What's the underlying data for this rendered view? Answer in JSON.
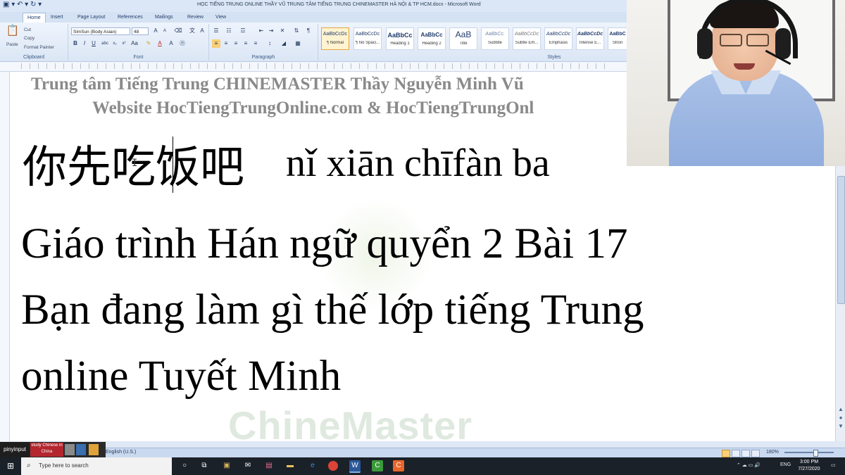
{
  "window": {
    "title": "HỌC TIẾNG TRUNG ONLINE THẦY VŨ TRUNG TÂM TIẾNG TRUNG CHINEMASTER HÀ NỘI & TP HCM.docx - Microsoft Word",
    "quick_access": "▣ ▾ ↶ ▾ ↻ ▾"
  },
  "ribbon": {
    "tabs": [
      "Home",
      "Insert",
      "Page Layout",
      "References",
      "Mailings",
      "Review",
      "View"
    ],
    "clipboard": {
      "label": "Clipboard",
      "paste": "Paste",
      "cut": "Cut",
      "copy": "Copy",
      "format_painter": "Format Painter"
    },
    "font": {
      "label": "Font",
      "name": "SimSun (Body Asian)",
      "size": "48"
    },
    "paragraph": {
      "label": "Paragraph"
    },
    "styles": {
      "label": "Styles",
      "items": [
        {
          "sample": "AaBbCcDc",
          "name": "¶ Normal"
        },
        {
          "sample": "AaBbCcDc",
          "name": "¶ No Spaci..."
        },
        {
          "sample": "AaBbCc",
          "name": "Heading 1"
        },
        {
          "sample": "AaBbCc",
          "name": "Heading 2"
        },
        {
          "sample": "AaB",
          "name": "Title"
        },
        {
          "sample": "AaBbCc.",
          "name": "Subtitle"
        },
        {
          "sample": "AaBbCcDc",
          "name": "Subtle Em..."
        },
        {
          "sample": "AaBbCcDc",
          "name": "Emphasis"
        },
        {
          "sample": "AaBbCcDc",
          "name": "Intense E..."
        },
        {
          "sample": "AaBbC",
          "name": "Stron"
        }
      ]
    }
  },
  "document": {
    "header_line1": "Trung tâm Tiếng Trung CHINEMASTER Thầy Nguyễn Minh Vũ",
    "header_line2": "Website HocTiengTrungOnline.com & HocTiengTrungOnl",
    "chinese": "你先吃饭吧",
    "pinyin": "nǐ xiān chīfàn ba",
    "body_line1": "Giáo trình Hán ngữ quyển 2 Bài 17",
    "body_line2": "Bạn đang làm gì thế lớp tiếng Trung",
    "body_line3": "online Tuyết Minh",
    "watermark": "ChineMaster"
  },
  "statusbar": {
    "language": "English (U.S.)",
    "zoom": "180%",
    "pinyinput": "pinyinput",
    "study_chinese": "study Chinese in China"
  },
  "taskbar": {
    "search_placeholder": "Type here to search",
    "lang": "ENG",
    "time": "3:00 PM",
    "date": "7/27/2020"
  },
  "colors": {
    "ribbon_bg": "#dbe6f5",
    "header_text": "#8a8a8a",
    "taskbar": "#1b2129",
    "selected_style": "#fff3d1"
  }
}
